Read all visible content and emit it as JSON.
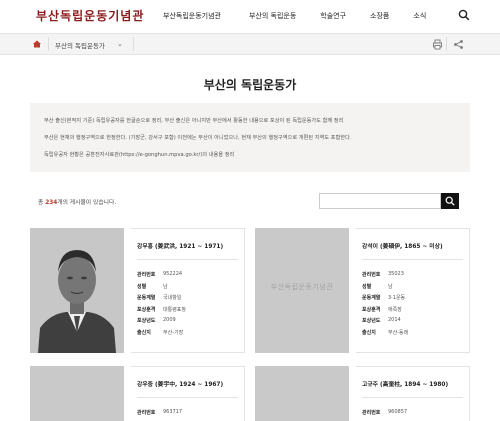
{
  "header": {
    "logo_text": "부산독립운동기념관",
    "nav": [
      "부산독립운동기념관",
      "부산의 독립운동",
      "학술연구",
      "소장품",
      "소식"
    ]
  },
  "location": {
    "current": "부산의 독립운동가"
  },
  "page": {
    "title": "부산의 독립운동가",
    "notes": [
      "부산 출신(본적지 기준) 독립유공자를 한글순으로 정리, 부산 출신은 아니지만 부산에서 활동한 내용으로 포상이 된 독립운동가도 함께 정리",
      "부산은 현재의 행정구역으로 한정한다. (기장군, 강서구 포함) 이전에는 부산이 아니었으나, 현재 부산의 행정구역으로 개편된 지역도 포함한다.",
      "독립유공자 현황은 공훈전자사료관(https://e-gonghun.mpva.go.kr/)의 내용을 정리"
    ]
  },
  "list": {
    "count_prefix": "총",
    "count": "234",
    "count_suffix": "개의 게시물이 있습니다.",
    "search_placeholder": ""
  },
  "cards": [
    {
      "name": "강무홍 (姜武洪, 1921 ~ 1971)",
      "has_photo": true,
      "fields": [
        {
          "k": "관리번호",
          "v": "952224"
        },
        {
          "k": "성별",
          "v": "남"
        },
        {
          "k": "운동계열",
          "v": "국내항일"
        },
        {
          "k": "포상훈격",
          "v": "대통령표창"
        },
        {
          "k": "포상년도",
          "v": "2009"
        },
        {
          "k": "출신지",
          "v": "부산-기장"
        }
      ]
    },
    {
      "name": "강석이 (姜碩伊, 1865 ~ 미상)",
      "has_photo": false,
      "placeholder_text": "부산독립운동기념관",
      "fields": [
        {
          "k": "관리번호",
          "v": "35023"
        },
        {
          "k": "성별",
          "v": "남"
        },
        {
          "k": "운동계열",
          "v": "3·1운동"
        },
        {
          "k": "포상훈격",
          "v": "애족장"
        },
        {
          "k": "포상년도",
          "v": "2014"
        },
        {
          "k": "출신지",
          "v": "부산-동래"
        }
      ]
    },
    {
      "name": "강우중 (姜宇中, 1924 ~ 1967)",
      "has_photo": false,
      "fields": [
        {
          "k": "관리번호",
          "v": "963717"
        }
      ]
    },
    {
      "name": "고규주 (高奎柱, 1894 ~ 1980)",
      "has_photo": false,
      "fields": [
        {
          "k": "관리번호",
          "v": "960857"
        }
      ]
    }
  ],
  "colors": {
    "logo": "#8a1c1c",
    "count_highlight": "#c0392b",
    "info_bg": "#f5f3f1",
    "search_button": "#111111"
  },
  "icons": {
    "search": "search-icon",
    "home": "home-icon",
    "print": "print-icon",
    "share": "share-icon",
    "chevron": "chevron-down-icon"
  }
}
